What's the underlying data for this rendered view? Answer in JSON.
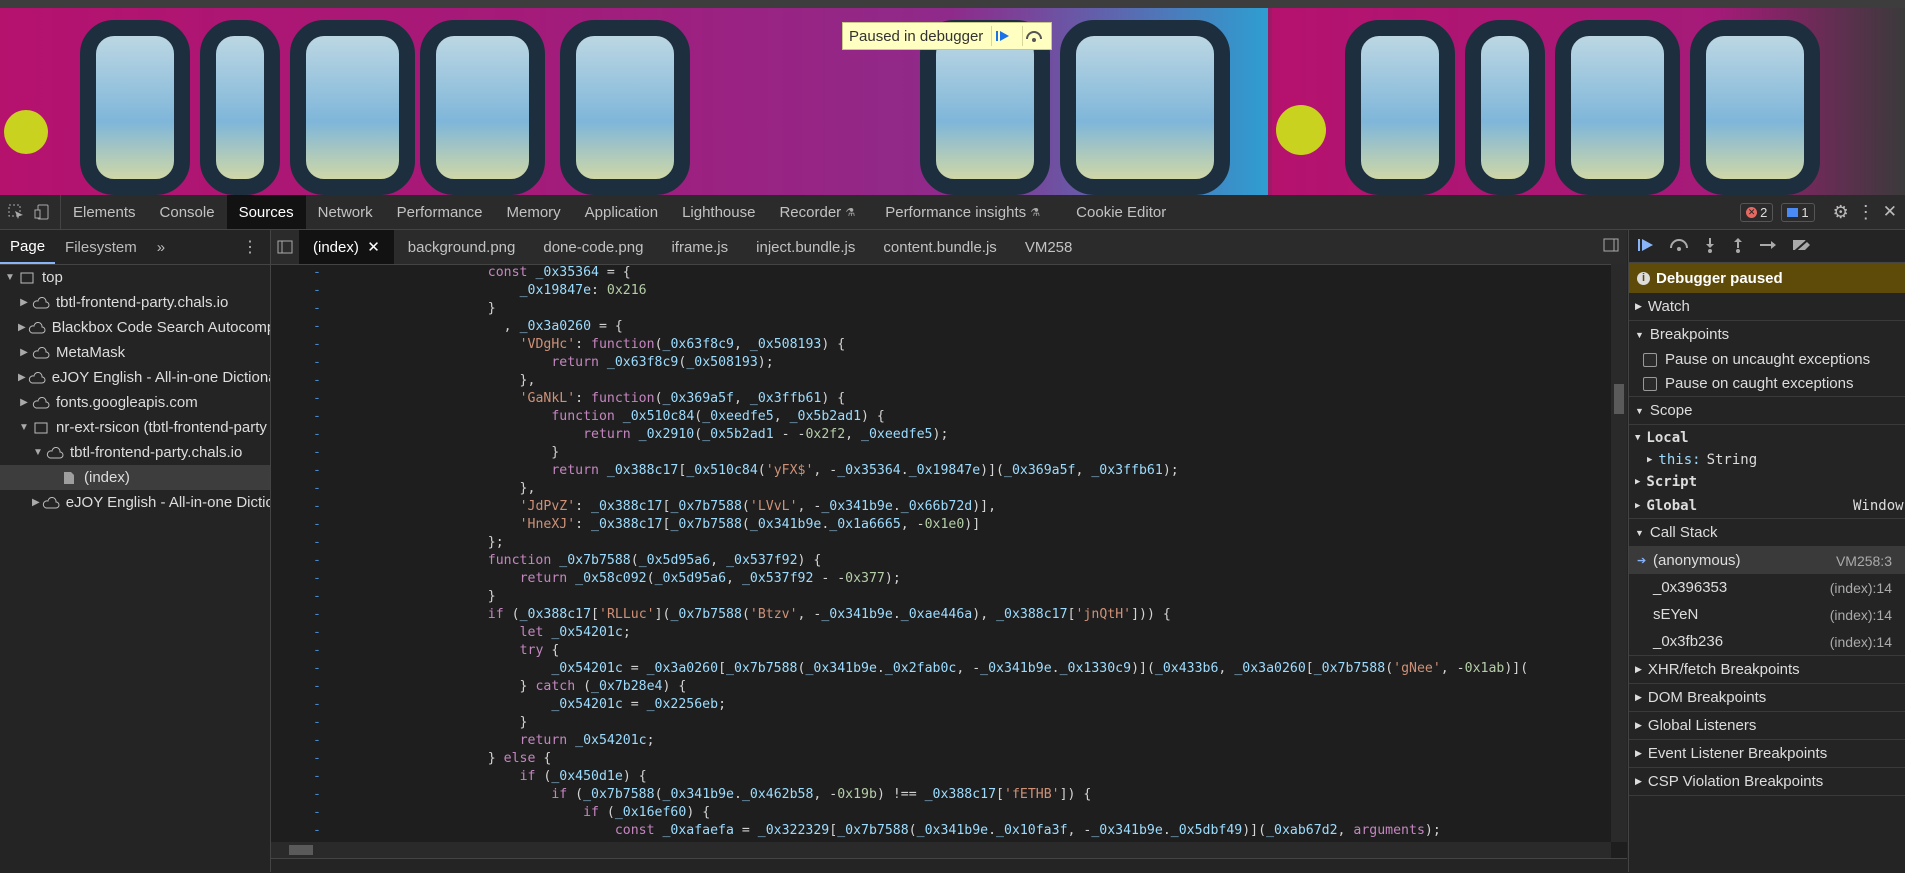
{
  "debugger_overlay": {
    "label": "Paused in debugger"
  },
  "toolbar": {
    "tabs": [
      "Elements",
      "Console",
      "Sources",
      "Network",
      "Performance",
      "Memory",
      "Application",
      "Lighthouse",
      "Recorder",
      "Performance insights",
      "Cookie Editor"
    ],
    "active_tab": "Sources",
    "errors_count": "2",
    "messages_count": "1"
  },
  "navigator": {
    "tabs": [
      "Page",
      "Filesystem"
    ],
    "more": "»",
    "tree": [
      {
        "label": "top",
        "level": 0,
        "expanded": true,
        "type": "frame"
      },
      {
        "label": "tbtl-frontend-party.chals.io",
        "level": 1,
        "type": "cloud"
      },
      {
        "label": "Blackbox Code Search Autocomp",
        "level": 1,
        "type": "cloud"
      },
      {
        "label": "MetaMask",
        "level": 1,
        "type": "cloud"
      },
      {
        "label": "eJOY English - All-in-one Dictiona",
        "level": 1,
        "type": "cloud"
      },
      {
        "label": "fonts.googleapis.com",
        "level": 1,
        "type": "cloud"
      },
      {
        "label": "nr-ext-rsicon (tbtl-frontend-party",
        "level": 1,
        "expanded": true,
        "type": "frame"
      },
      {
        "label": "tbtl-frontend-party.chals.io",
        "level": 2,
        "expanded": true,
        "type": "cloud"
      },
      {
        "label": "(index)",
        "level": 3,
        "type": "file",
        "selected": true
      },
      {
        "label": "eJOY English - All-in-one Dictic",
        "level": 2,
        "type": "cloud"
      }
    ]
  },
  "editor": {
    "tabs": [
      "(index)",
      "background.png",
      "done-code.png",
      "iframe.js",
      "inject.bundle.js",
      "content.bundle.js",
      "VM258"
    ],
    "active_tab": "(index)",
    "gutter": "-",
    "lines": [
      "                    const _0x35364 = {",
      "                        _0x19847e: 0x216",
      "                    }",
      "                      , _0x3a0260 = {",
      "                        'VDgHc': function(_0x63f8c9, _0x508193) {",
      "                            return _0x63f8c9(_0x508193);",
      "                        },",
      "                        'GaNkL': function(_0x369a5f, _0x3ffb61) {",
      "                            function _0x510c84(_0xeedfe5, _0x5b2ad1) {",
      "                                return _0x2910(_0x5b2ad1 - -0x2f2, _0xeedfe5);",
      "                            }",
      "                            return _0x388c17[_0x510c84('yFX$', -_0x35364._0x19847e)](_0x369a5f, _0x3ffb61);",
      "                        },",
      "                        'JdPvZ': _0x388c17[_0x7b7588('LVvL', -_0x341b9e._0x66b72d)],",
      "                        'HneXJ': _0x388c17[_0x7b7588(_0x341b9e._0x1a6665, -0x1e0)]",
      "                    };",
      "                    function _0x7b7588(_0x5d95a6, _0x537f92) {",
      "                        return _0x58c092(_0x5d95a6, _0x537f92 - -0x377);",
      "                    }",
      "                    if (_0x388c17['RLLuc'](_0x7b7588('Btzv', -_0x341b9e._0xae446a), _0x388c17['jnQtH'])) {",
      "                        let _0x54201c;",
      "                        try {",
      "                            _0x54201c = _0x3a0260[_0x7b7588(_0x341b9e._0x2fab0c, -_0x341b9e._0x1330c9)](_0x433b6, _0x3a0260[_0x7b7588('gNee', -0x1ab)](",
      "                        } catch (_0x7b28e4) {",
      "                            _0x54201c = _0x2256eb;",
      "                        }",
      "                        return _0x54201c;",
      "                    } else {",
      "                        if (_0x450d1e) {",
      "                            if (_0x7b7588(_0x341b9e._0x462b58, -0x19b) !== _0x388c17['fETHB']) {",
      "                                if (_0x16ef60) {",
      "                                    const _0xafaefa = _0x322329[_0x7b7588(_0x341b9e._0x10fa3f, -_0x341b9e._0x5dbf49)](_0xab67d2, arguments);"
    ]
  },
  "debugger": {
    "paused_label": "Debugger paused",
    "sections": {
      "watch": "Watch",
      "breakpoints": "Breakpoints",
      "pause_uncaught": "Pause on uncaught exceptions",
      "pause_caught": "Pause on caught exceptions",
      "scope": "Scope",
      "local": "Local",
      "this_key": "this:",
      "this_val": "String",
      "script": "Script",
      "global": "Global",
      "global_val": "Window",
      "call_stack": "Call Stack",
      "xhr": "XHR/fetch Breakpoints",
      "dom": "DOM Breakpoints",
      "global_listeners": "Global Listeners",
      "event_listener": "Event Listener Breakpoints",
      "csp": "CSP Violation Breakpoints"
    },
    "call_stack": [
      {
        "fn": "(anonymous)",
        "loc": "VM258:3",
        "current": true
      },
      {
        "fn": "_0x396353",
        "loc": "(index):14"
      },
      {
        "fn": "sEYeN",
        "loc": "(index):14"
      },
      {
        "fn": "_0x3fb236",
        "loc": "(index):14"
      }
    ]
  },
  "colors": {
    "accent": "#8ab4f8",
    "paused_bg": "#5f4b09",
    "overlay_bg": "#ffffc2"
  }
}
